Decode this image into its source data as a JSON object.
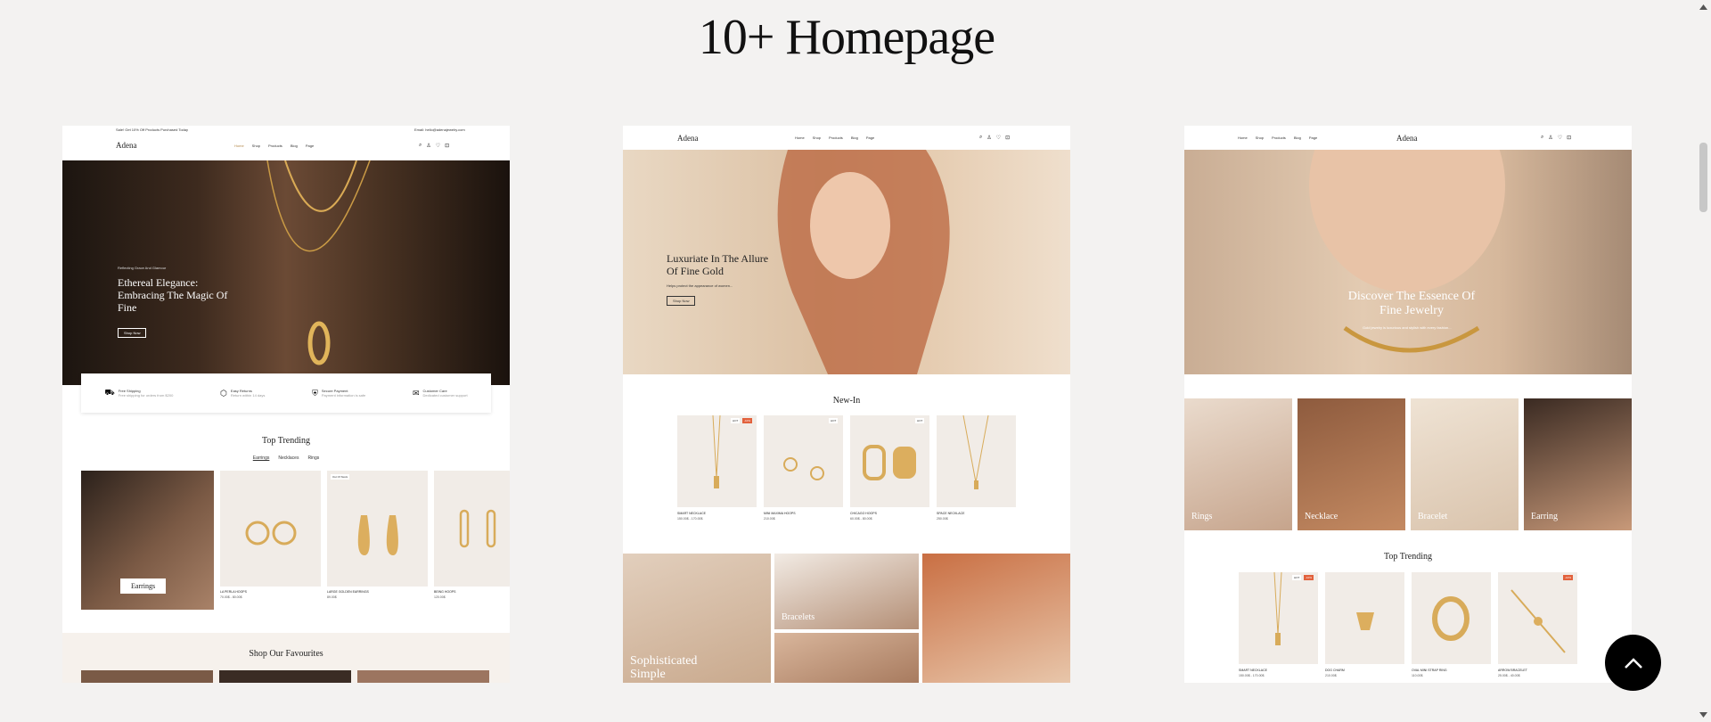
{
  "page": {
    "title": "10+ Homepage"
  },
  "card1": {
    "announcement": "Sale! Get 10% Off Products Purchased Today",
    "email": "Email: hello@adenajewelry.com",
    "logo": "Adena",
    "menu": [
      "Home",
      "Shop",
      "Products",
      "Blog",
      "Page"
    ],
    "hero": {
      "eyebrow": "Reflecting Grace And Glamour",
      "title": "Ethereal Elegance: Embracing The Magic Of Fine",
      "button": "Shop Now"
    },
    "features": [
      {
        "title": "Free Shipping",
        "sub": "Free shipping for orders from $200"
      },
      {
        "title": "Easy Returns",
        "sub": "Return within 14 days"
      },
      {
        "title": "Secure Payment",
        "sub": "Payment information is safe"
      },
      {
        "title": "Customer Care",
        "sub": "Dedicated customer support"
      }
    ],
    "trending": {
      "title": "Top Trending",
      "tabs": [
        "Earrings",
        "Necklaces",
        "Rings"
      ]
    },
    "category_button": "Earrings",
    "products": [
      {
        "name": "LA PERLA HOOPS",
        "price": "70.00$ - 80.00$",
        "badge": ""
      },
      {
        "name": "LARGE GOLDEN EARRINGS",
        "price": "89.00$",
        "badge": "Out Of Stock"
      },
      {
        "name": "BEING HOOPS",
        "price": "120.00$",
        "badge": ""
      }
    ],
    "favourites_title": "Shop Our Favourites"
  },
  "card2": {
    "logo": "Adena",
    "menu": [
      "Home",
      "Shop",
      "Products",
      "Blog",
      "Page"
    ],
    "hero": {
      "title": "Luxuriate In The Allure Of Fine Gold",
      "sub": "Helps protect the appearance of women...",
      "button": "Shop Now"
    },
    "newin_title": "New-In",
    "products": [
      {
        "name": "SMART NECKLACE",
        "price": "150.00$ - 170.00$",
        "badges": [
          "HOT",
          "-10%"
        ]
      },
      {
        "name": "MINI MAXIMA HOOPS",
        "price": "210.00$",
        "badges": [
          "HOT"
        ]
      },
      {
        "name": "CHICAGO HOOPS",
        "price": "60.00$ - 80.00$",
        "badges": [
          "HOT"
        ]
      },
      {
        "name": "SPACE NECKLACE",
        "price": "250.00$",
        "badges": []
      }
    ],
    "categories": [
      {
        "label": "Sophisticated Simple"
      },
      {
        "label": "Bracelets"
      }
    ]
  },
  "card3": {
    "logo": "Adena",
    "menu": [
      "Home",
      "Shop",
      "Products",
      "Blog",
      "Page"
    ],
    "hero": {
      "title": "Discover The Essence Of Fine Jewelry",
      "sub": "Gold jewelry is luxurious and stylish with every fashion..."
    },
    "categories": [
      "Rings",
      "Necklace",
      "Bracelet",
      "Earring"
    ],
    "trending_title": "Top Trending",
    "products": [
      {
        "name": "SMART NECKLACE",
        "price": "150.00$ - 170.00$",
        "badges": [
          "HOT",
          "-10%"
        ]
      },
      {
        "name": "DOG CHARM",
        "price": "210.00$",
        "badges": []
      },
      {
        "name": "OVAL MINI STRAP RING",
        "price": "110.00$",
        "badges": []
      },
      {
        "name": "ARROW BRACELET",
        "price": "25.00$ - 40.00$",
        "badges": [
          "-10%"
        ]
      }
    ]
  },
  "icons": {
    "scroll_up": "chevron-up-icon"
  },
  "colors": {
    "page_bg": "#f3f2f1",
    "accent": "#b5894c",
    "sale": "#e2613c"
  }
}
